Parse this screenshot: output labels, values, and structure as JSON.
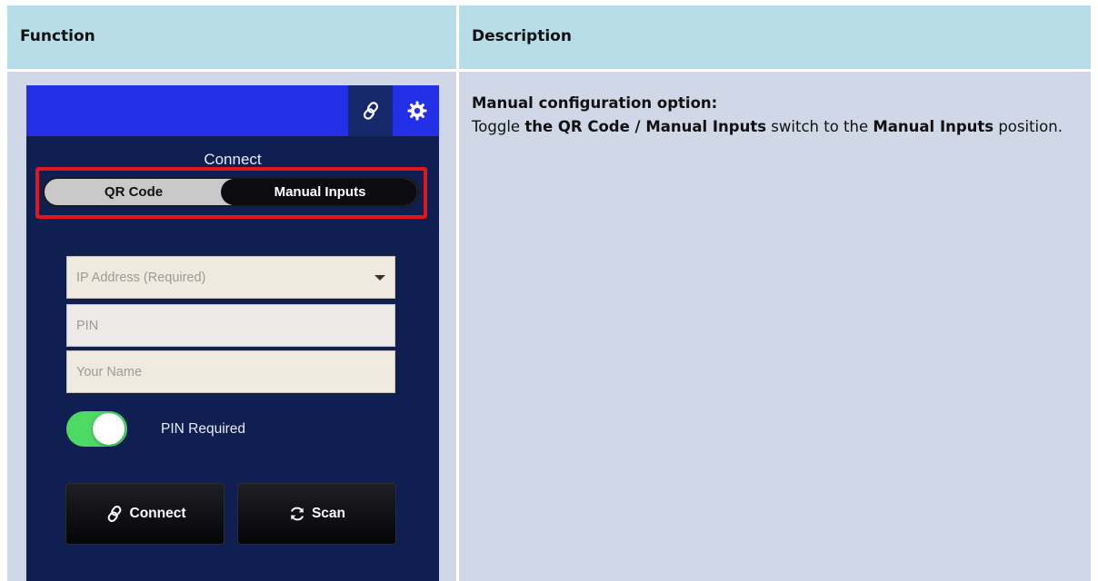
{
  "table": {
    "headers": [
      "Function",
      "Description"
    ],
    "description_heading": "Manual configuration option:",
    "description_parts": [
      "Toggle ",
      "the QR Code / Manual Inputs",
      " switch to the ",
      "Manual Inputs",
      " position."
    ]
  },
  "app": {
    "topbar": {
      "link_icon": "link-icon",
      "settings_icon": "gear-icon"
    },
    "connect_title": "Connect",
    "mode_switch": {
      "left_label": "QR Code",
      "right_label": "Manual Inputs",
      "selected": "Manual Inputs"
    },
    "fields": {
      "ip_placeholder": "IP Address (Required)",
      "pin_placeholder": "PIN",
      "name_placeholder": "Your Name"
    },
    "pin_toggle": {
      "label": "PIN Required",
      "on": true
    },
    "buttons": {
      "connect": "Connect",
      "scan": "Scan"
    }
  },
  "colors": {
    "header_bg": "#b7dde8",
    "cell_bg": "#d0d8e7",
    "phone_bg": "#0f1f52",
    "topbar_bg": "#2430e8",
    "highlight": "#e3161c",
    "toggle_on": "#4cd964"
  }
}
